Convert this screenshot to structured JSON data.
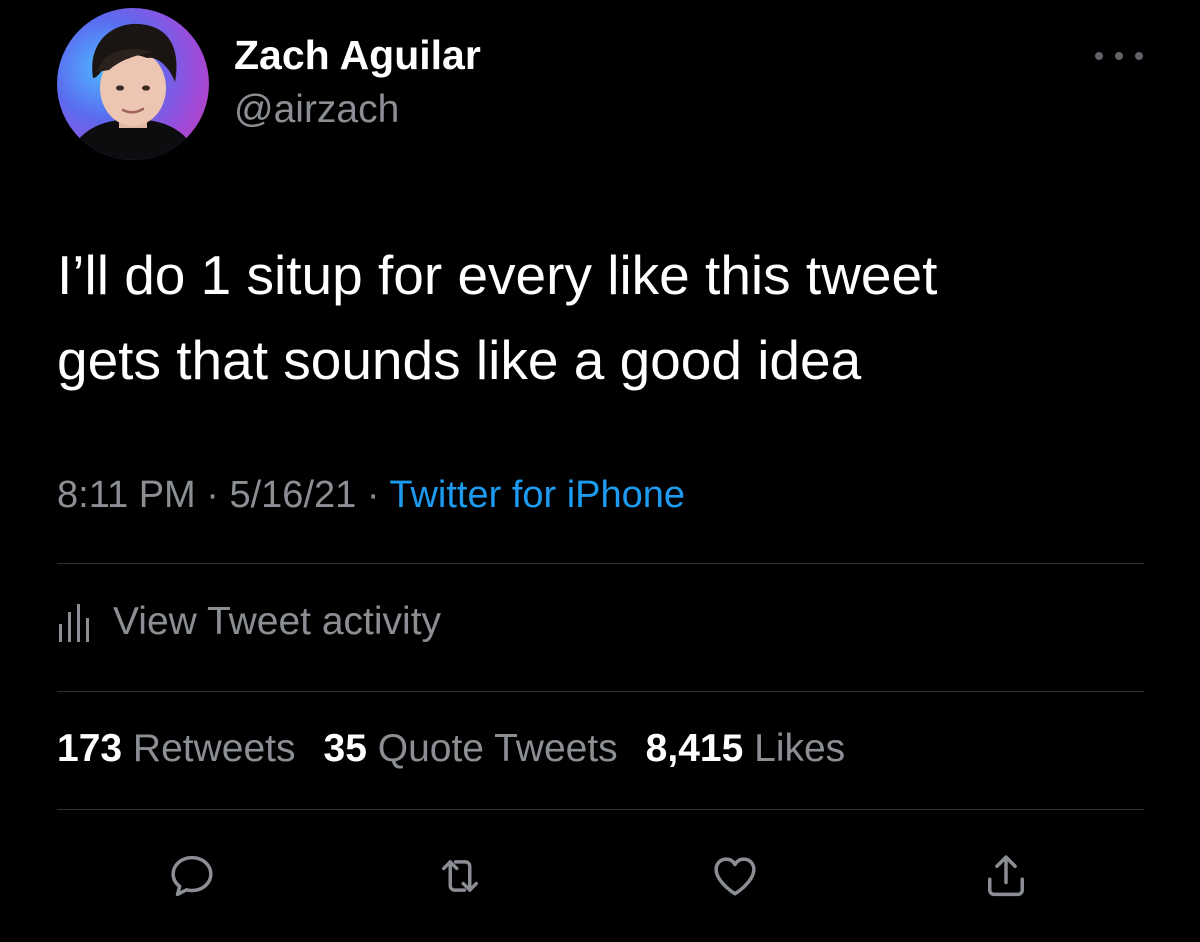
{
  "author": {
    "display_name": "Zach Aguilar",
    "handle": "@airzach"
  },
  "tweet": {
    "text": "I’ll do 1 situp for every like this tweet\ngets that sounds like a good idea",
    "time": "8:11 PM",
    "date": "5/16/21",
    "separator": " · ",
    "source": "Twitter for iPhone"
  },
  "activity": {
    "label": "View Tweet activity"
  },
  "stats": {
    "retweets_count": "173",
    "retweets_label": "Retweets",
    "quotes_count": "35",
    "quotes_label": "Quote Tweets",
    "likes_count": "8,415",
    "likes_label": "Likes"
  },
  "icons": {
    "more": "more-horizontal-icon",
    "activity": "bar-chart-icon",
    "reply": "reply-icon",
    "retweet": "retweet-icon",
    "like": "heart-icon",
    "share": "share-icon"
  },
  "colors": {
    "background": "#000000",
    "text_primary": "#ffffff",
    "text_secondary": "#8b8f94",
    "link": "#1d9bf0",
    "divider": "#2f3336"
  }
}
